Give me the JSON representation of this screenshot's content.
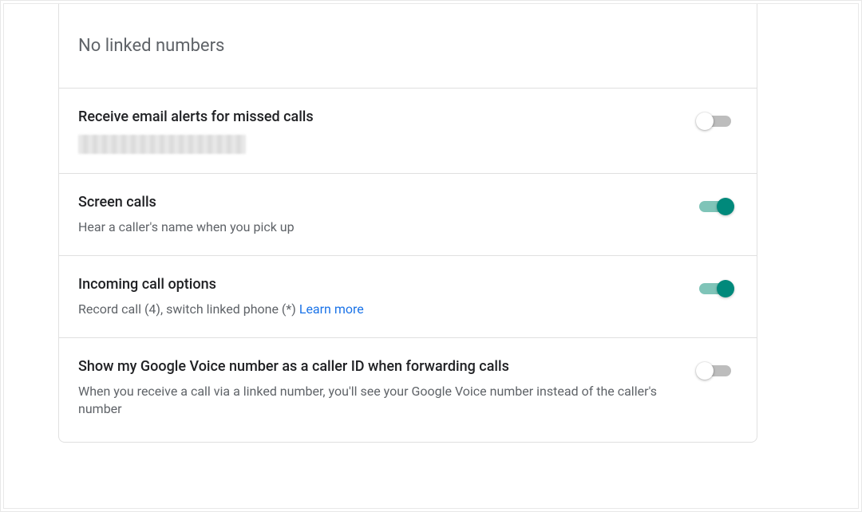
{
  "colors": {
    "toggle_on_thumb": "#00897b",
    "toggle_on_track": "#7fc4b8",
    "toggle_off_thumb": "#ffffff",
    "toggle_off_track": "#bdbdbd",
    "link": "#1a73e8"
  },
  "linked_numbers": {
    "empty_text": "No linked numbers"
  },
  "settings": {
    "email_alerts": {
      "title": "Receive email alerts for missed calls",
      "detail_redacted": true,
      "enabled": false
    },
    "screen_calls": {
      "title": "Screen calls",
      "desc": "Hear a caller's name when you pick up",
      "enabled": true
    },
    "incoming_options": {
      "title": "Incoming call options",
      "desc_pre": "Record call (4), switch linked phone (*) ",
      "learn_more": "Learn more",
      "enabled": true
    },
    "caller_id": {
      "title": "Show my Google Voice number as a caller ID when forwarding calls",
      "desc": "When you receive a call via a linked number, you'll see your Google Voice number instead of the caller's number",
      "enabled": false
    }
  }
}
